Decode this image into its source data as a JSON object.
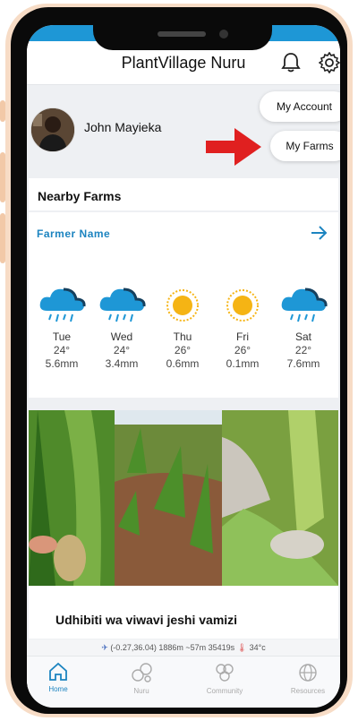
{
  "app": {
    "title": "PlantVillage Nuru"
  },
  "user": {
    "name": "John Mayieka"
  },
  "menu": {
    "my_account": "My Account",
    "my_farms": "My Farms"
  },
  "nearby": {
    "title": "Nearby Farms",
    "farmer_name": "Farmer Name"
  },
  "weather": [
    {
      "day": "Tue",
      "temp": "24°",
      "rain": "5.6mm",
      "icon": "rain-cloud-icon"
    },
    {
      "day": "Wed",
      "temp": "24°",
      "rain": "3.4mm",
      "icon": "rain-cloud-icon"
    },
    {
      "day": "Thu",
      "temp": "26°",
      "rain": "0.6mm",
      "icon": "sun-icon"
    },
    {
      "day": "Fri",
      "temp": "26°",
      "rain": "0.1mm",
      "icon": "sun-icon"
    },
    {
      "day": "Sat",
      "temp": "22°",
      "rain": "7.6mm",
      "icon": "rain-cloud-icon"
    }
  ],
  "news": {
    "headline": "Udhibiti wa viwavi jeshi vamizi"
  },
  "status": {
    "coords": "(-0.27,36.04) 1886m ~57m 35419s",
    "temp": "34°c"
  },
  "nav": [
    {
      "label": "Home",
      "icon": "home-icon"
    },
    {
      "label": "Nuru",
      "icon": "nuru-icon"
    },
    {
      "label": "Community",
      "icon": "community-icon"
    },
    {
      "label": "Resources",
      "icon": "globe-icon"
    }
  ],
  "colors": {
    "accent": "#1c84c0",
    "brand_bar": "#1e97d6",
    "arrow_annotation": "#e02020"
  }
}
